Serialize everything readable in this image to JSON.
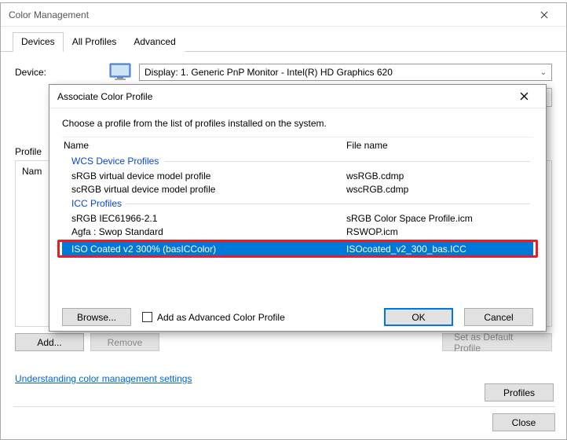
{
  "main": {
    "title": "Color Management",
    "tabs": [
      "Devices",
      "All Profiles",
      "Advanced"
    ],
    "active_tab": 0,
    "device_label": "Device:",
    "device_select_value": "Display: 1. Generic PnP Monitor - Intel(R) HD Graphics 620",
    "profiles_label": "Profile",
    "profiles_header": "Nam",
    "add_button": "Add...",
    "remove_button": "Remove",
    "set_default_button": "Set as Default Profile",
    "link": "Understanding color management settings",
    "profiles_button": "Profiles",
    "close_button": "Close"
  },
  "dialog": {
    "title": "Associate Color Profile",
    "instruction": "Choose a profile from the list of profiles installed on the system.",
    "columns": {
      "name": "Name",
      "file": "File name"
    },
    "groups": [
      {
        "label": "WCS Device Profiles",
        "rows": [
          {
            "name": "sRGB virtual device model profile",
            "file": "wsRGB.cdmp"
          },
          {
            "name": "scRGB virtual device model profile",
            "file": "wscRGB.cdmp"
          }
        ]
      },
      {
        "label": "ICC Profiles",
        "rows": [
          {
            "name": "sRGB IEC61966-2.1",
            "file": "sRGB Color Space Profile.icm"
          },
          {
            "name": "Agfa : Swop Standard",
            "file": "RSWOP.icm"
          }
        ]
      }
    ],
    "selected": {
      "name": "ISO Coated v2 300% (basICColor)",
      "file": "ISOcoated_v2_300_bas.ICC"
    },
    "browse_button": "Browse...",
    "checkbox_label": "Add as Advanced Color Profile",
    "ok_button": "OK",
    "cancel_button": "Cancel"
  }
}
